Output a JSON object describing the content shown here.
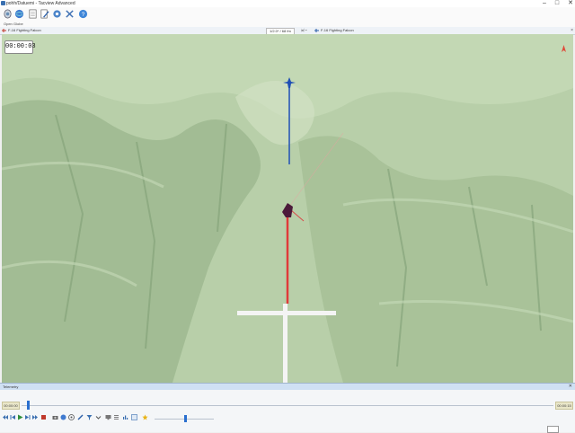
{
  "window": {
    "title": "pohh/Datuemi - Tacview Advanced",
    "min": "–",
    "max": "□",
    "close": "✕"
  },
  "toolbar": {
    "buttons": [
      {
        "name": "open-icon",
        "label": "Open"
      },
      {
        "name": "globe-icon",
        "label": "Globe"
      },
      {
        "name": "document-icon",
        "label": ""
      },
      {
        "name": "edit-icon",
        "label": ""
      },
      {
        "name": "settings-icon",
        "label": ""
      },
      {
        "name": "tools-icon",
        "label": ""
      },
      {
        "name": "help-icon",
        "label": ""
      }
    ]
  },
  "ribbon": {
    "left_object": "F-16 Fighting Falcon",
    "center_field": "1/2.0* / 68 fm",
    "selector": "🗐 ▾",
    "right_object": "F-16 Fighting Falcon",
    "close": "×"
  },
  "map": {
    "timer": "00:00:03"
  },
  "bottom": {
    "panel_title": "Telemetry",
    "time_start": "00:00:00",
    "time_end": "00:00:15",
    "playback_position": 0.01,
    "speed_position": 0.5
  }
}
